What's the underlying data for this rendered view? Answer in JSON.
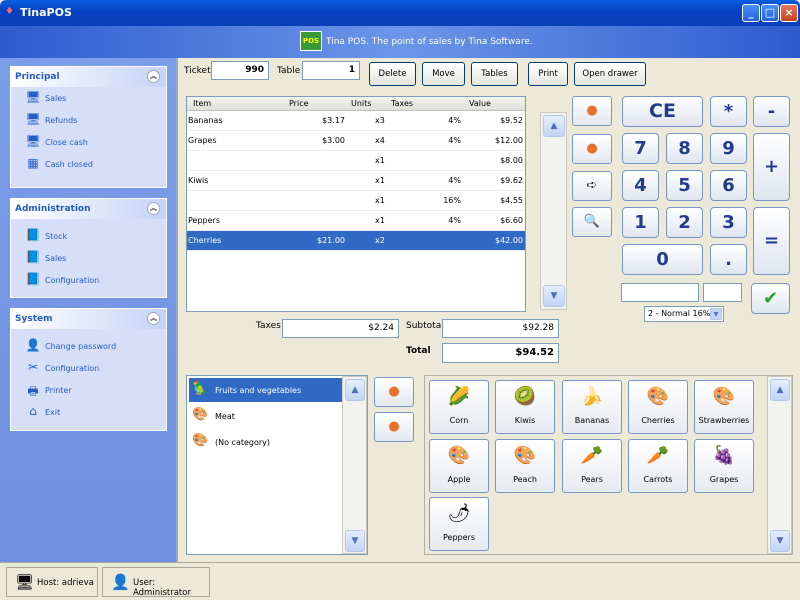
{
  "window": {
    "title": "TinaPOS",
    "banner": "Tina POS. The point of sales by Tina Software."
  },
  "sidebar": {
    "panels": [
      {
        "title": "Principal",
        "items": [
          {
            "label": "Sales",
            "icon": "monitor-icon"
          },
          {
            "label": "Refunds",
            "icon": "monitor-icon"
          },
          {
            "label": "Close cash",
            "icon": "monitor-icon"
          },
          {
            "label": "Cash closed",
            "icon": "calendar-icon"
          }
        ]
      },
      {
        "title": "Administration",
        "items": [
          {
            "label": "Stock",
            "icon": "book-icon"
          },
          {
            "label": "Sales",
            "icon": "book-icon"
          },
          {
            "label": "Configuration",
            "icon": "book-icon"
          }
        ]
      },
      {
        "title": "System",
        "items": [
          {
            "label": "Change password",
            "icon": "user-icon"
          },
          {
            "label": "Configuration",
            "icon": "tools-icon"
          },
          {
            "label": "Printer",
            "icon": "printer-icon"
          },
          {
            "label": "Exit",
            "icon": "home-icon"
          }
        ]
      }
    ]
  },
  "ticket": {
    "ticket_label": "Ticket",
    "ticket_value": "990",
    "table_label": "Table",
    "table_value": "1"
  },
  "toolbar": {
    "delete": "Delete",
    "move": "Move",
    "tables": "Tables",
    "print": "Print",
    "open_drawer": "Open drawer"
  },
  "lines": {
    "columns": [
      "Item",
      "Price",
      "Units",
      "Taxes",
      "Value"
    ],
    "rows": [
      [
        "Bananas",
        "$3.17",
        "x3",
        "4%",
        "$9.52"
      ],
      [
        "Grapes",
        "$3.00",
        "x4",
        "4%",
        "$12.00"
      ],
      [
        "",
        "",
        "x1",
        "",
        "$8.00"
      ],
      [
        "Kiwis",
        "",
        "x1",
        "4%",
        "$9.62"
      ],
      [
        "",
        "",
        "x1",
        "16%",
        "$4.55"
      ],
      [
        "Peppers",
        "",
        "x1",
        "4%",
        "$6.60"
      ],
      [
        "Cherries",
        "$21.00",
        "x2",
        "",
        "$42.00"
      ]
    ]
  },
  "totals": {
    "taxes_label": "Taxes",
    "taxes": "$2.24",
    "subtotal_label": "Subtotal",
    "subtotal": "$92.28",
    "total_label": "Total",
    "total": "$94.52"
  },
  "keypad": {
    "ce": "CE",
    "mult": "*",
    "minus": "-",
    "plus": "+",
    "equals": "=",
    "dot": ".",
    "digits": [
      "7",
      "8",
      "9",
      "4",
      "5",
      "6",
      "1",
      "2",
      "3",
      "0"
    ],
    "tax_select": "2 - Normal 16%",
    "ok": "✔"
  },
  "categories": [
    {
      "label": "Fruits and vegetables",
      "icon": "parrot-icon"
    },
    {
      "label": "Meat",
      "icon": "palette-icon"
    },
    {
      "label": "(No category)",
      "icon": "palette-icon"
    }
  ],
  "products": [
    {
      "label": "Corn",
      "icon": "corn-icon"
    },
    {
      "label": "Kiwis",
      "icon": "kiwi-icon"
    },
    {
      "label": "Bananas",
      "icon": "banana-icon"
    },
    {
      "label": "Cherries",
      "icon": "palette-icon"
    },
    {
      "label": "Strawberries",
      "icon": "palette-icon"
    },
    {
      "label": "Apple",
      "icon": "palette-icon"
    },
    {
      "label": "Peach",
      "icon": "palette-icon"
    },
    {
      "label": "Pears",
      "icon": "carrot-icon"
    },
    {
      "label": "Carrots",
      "icon": "carrot-icon"
    },
    {
      "label": "Grapes",
      "icon": "grape-icon"
    },
    {
      "label": "Peppers",
      "icon": "pepper-icon"
    }
  ],
  "status": {
    "host": "Host: adrieva",
    "user": "User: Administrator"
  }
}
